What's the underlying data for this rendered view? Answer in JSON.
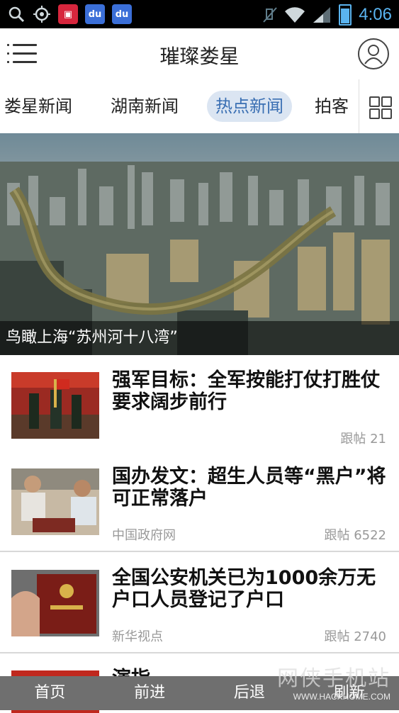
{
  "status_bar": {
    "time": "4:06",
    "icons": [
      "search-icon",
      "location-icon",
      "tv-app-icon",
      "baidu-paw-icon",
      "baidu-paw-icon",
      "mute-icon",
      "wifi-icon",
      "signal-icon",
      "battery-icon"
    ]
  },
  "app_bar": {
    "title": "璀璨娄星"
  },
  "tabs": [
    {
      "label": "娄星新闻",
      "active": false
    },
    {
      "label": "湖南新闻",
      "active": false
    },
    {
      "label": "热点新闻",
      "active": true
    },
    {
      "label": "拍客",
      "active": false
    }
  ],
  "hero": {
    "caption": "鸟瞰上海“苏州河十八湾”"
  },
  "news": [
    {
      "title": "强军目标：全军按能打仗打胜仗要求阔步前行",
      "source": "",
      "count": "跟帖 21"
    },
    {
      "title": "国办发文：超生人员等“黑户”将可正常落户",
      "source": "中国政府网",
      "count": "跟帖 6522"
    },
    {
      "title": "全国公安机关已为1000余万无户口人员登记了户口",
      "source": "新华视点",
      "count": "跟帖 2740"
    },
    {
      "title": "演指…",
      "source": "",
      "count": ""
    }
  ],
  "bottom_bar": {
    "home": "首页",
    "forward": "前进",
    "back": "后退",
    "refresh": "刷新"
  },
  "watermark": {
    "text_cn": "网侠手机站",
    "text_en": "WWW.HACKHOME.COM"
  },
  "colors": {
    "tab_active_bg": "#dbe5f2",
    "tab_active_text": "#3a6fb3",
    "status_accent": "#5ab4f0",
    "bottom_bar_bg": "#6f6f6f"
  }
}
